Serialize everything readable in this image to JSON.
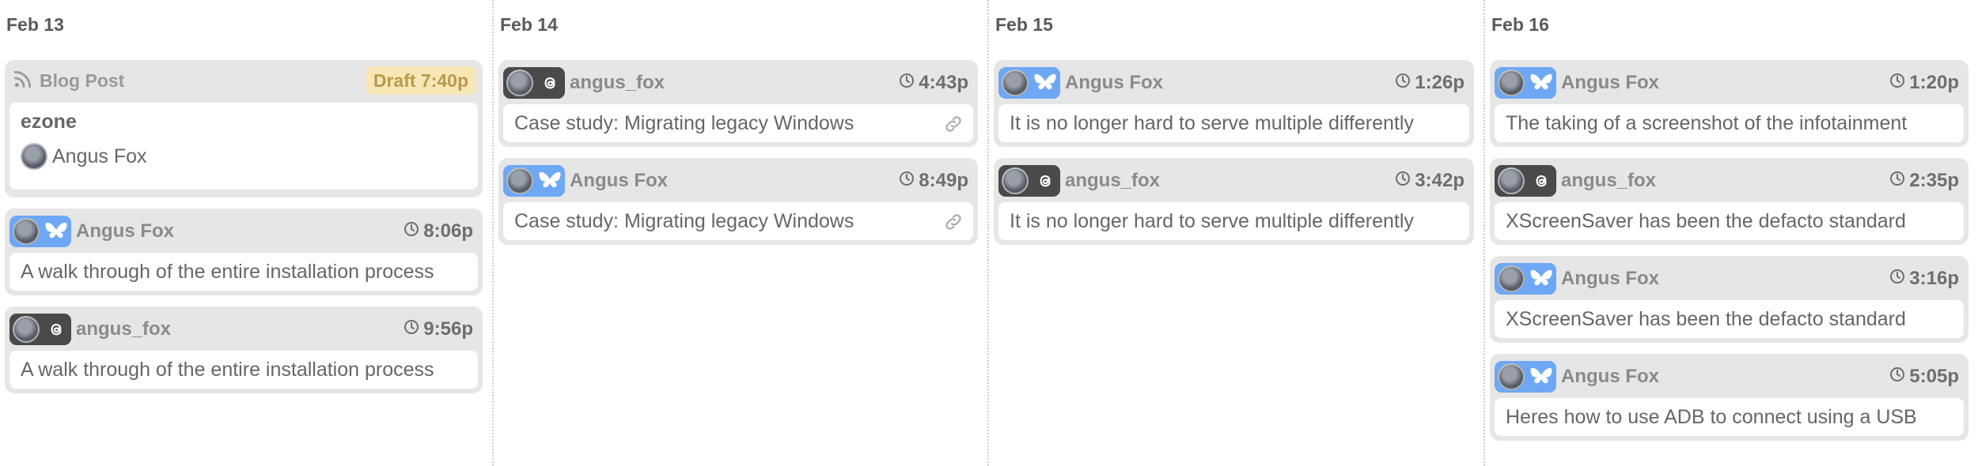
{
  "columns": [
    {
      "title": "Feb 13",
      "blog": {
        "label": "Blog Post",
        "draft": "Draft 7:40p",
        "name": "ezone",
        "author": "Angus Fox"
      },
      "cards": [
        {
          "network": "bluesky",
          "author": "Angus Fox",
          "time": "8:06p",
          "text": "A walk through of the entire installation process",
          "link": false
        },
        {
          "network": "threads",
          "author": "angus_fox",
          "time": "9:56p",
          "text": "A walk through of the entire installation process",
          "link": false
        }
      ]
    },
    {
      "title": "Feb 14",
      "cards": [
        {
          "network": "threads",
          "author": "angus_fox",
          "time": "4:43p",
          "text": "Case study: Migrating legacy Windows",
          "link": true
        },
        {
          "network": "bluesky",
          "author": "Angus Fox",
          "time": "8:49p",
          "text": "Case study: Migrating legacy Windows",
          "link": true
        }
      ]
    },
    {
      "title": "Feb 15",
      "cards": [
        {
          "network": "bluesky",
          "author": "Angus Fox",
          "time": "1:26p",
          "text": "It is no longer hard to serve multiple differently",
          "link": false
        },
        {
          "network": "threads",
          "author": "angus_fox",
          "time": "3:42p",
          "text": "It is no longer hard to serve multiple differently",
          "link": false
        }
      ]
    },
    {
      "title": "Feb 16",
      "cards": [
        {
          "network": "bluesky",
          "author": "Angus Fox",
          "time": "1:20p",
          "text": "The taking of a screenshot of the infotainment",
          "link": false
        },
        {
          "network": "threads",
          "author": "angus_fox",
          "time": "2:35p",
          "text": "XScreenSaver has been the defacto standard",
          "link": false
        },
        {
          "network": "bluesky",
          "author": "Angus Fox",
          "time": "3:16p",
          "text": "XScreenSaver has been the defacto standard",
          "link": false
        },
        {
          "network": "bluesky",
          "author": "Angus Fox",
          "time": "5:05p",
          "text": "Heres how to use ADB to connect using a USB",
          "link": false
        }
      ]
    }
  ],
  "icons": {
    "bluesky": "butterfly-icon",
    "threads": "threads-icon",
    "time": "clock-icon",
    "link": "link-icon",
    "blog": "rss-icon"
  },
  "colors": {
    "bluesky_badge": "#6ea8f5",
    "threads_badge": "#4a4a4a",
    "draft_bg": "#f7e7b7",
    "draft_text": "#b89a4a"
  }
}
